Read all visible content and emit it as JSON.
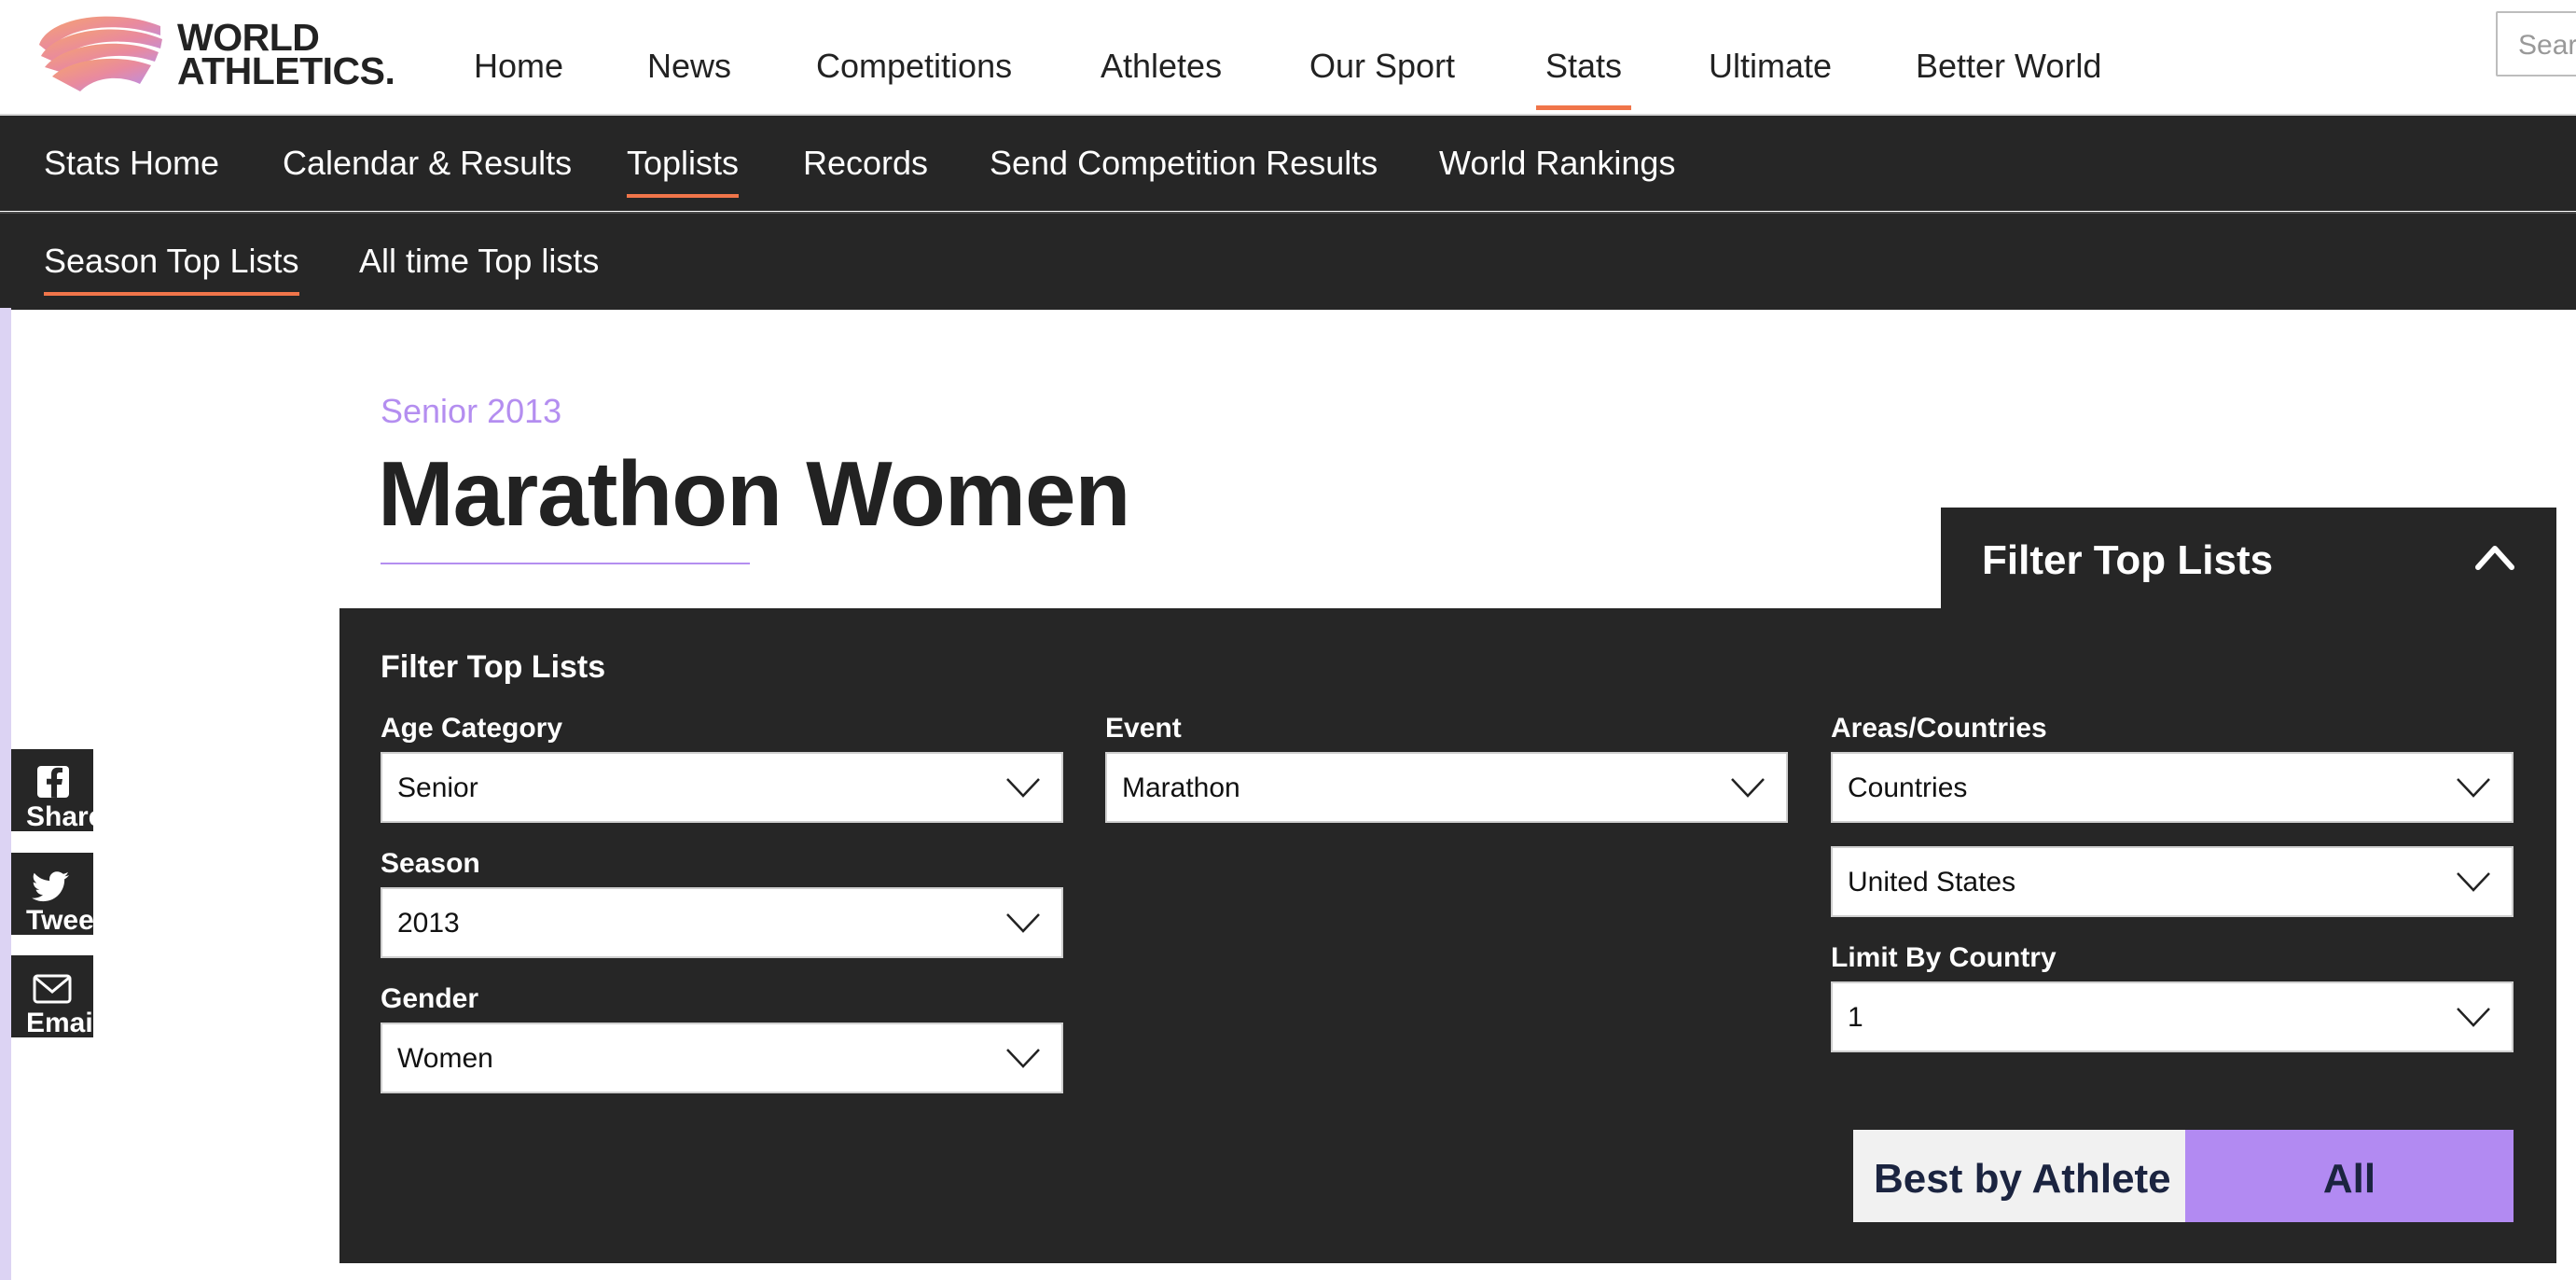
{
  "brand": {
    "logo_line1": "WORLD",
    "logo_line2": "ATHLETICS.",
    "colors": {
      "accent_orange": "#f0754a",
      "accent_purple": "#b48ef0",
      "dark": "#262626"
    }
  },
  "main_nav": {
    "items": [
      {
        "label": "Home",
        "active": false
      },
      {
        "label": "News",
        "active": false
      },
      {
        "label": "Competitions",
        "active": false
      },
      {
        "label": "Athletes",
        "active": false
      },
      {
        "label": "Our Sport",
        "active": false
      },
      {
        "label": "Stats",
        "active": true
      },
      {
        "label": "Ultimate",
        "active": false
      },
      {
        "label": "Better World",
        "active": false
      }
    ],
    "search_placeholder": "Search"
  },
  "stats_nav": {
    "items": [
      {
        "label": "Stats Home",
        "active": false
      },
      {
        "label": "Calendar & Results",
        "active": false
      },
      {
        "label": "Toplists",
        "active": true
      },
      {
        "label": "Records",
        "active": false
      },
      {
        "label": "Send Competition Results",
        "active": false
      },
      {
        "label": "World Rankings",
        "active": false
      }
    ]
  },
  "toplists_nav": {
    "items": [
      {
        "label": "Season Top Lists",
        "active": true
      },
      {
        "label": "All time Top lists",
        "active": false
      }
    ]
  },
  "share": {
    "facebook_label": "Share",
    "twitter_label": "Tweet",
    "email_label": "Email"
  },
  "page": {
    "subtitle": "Senior 2013",
    "title": "Marathon Women"
  },
  "filter": {
    "toggle_label": "Filter Top Lists",
    "panel_title": "Filter Top Lists",
    "age_category": {
      "label": "Age Category",
      "value": "Senior"
    },
    "season": {
      "label": "Season",
      "value": "2013"
    },
    "gender": {
      "label": "Gender",
      "value": "Women"
    },
    "event": {
      "label": "Event",
      "value": "Marathon"
    },
    "areas": {
      "label": "Areas/Countries",
      "value": "Countries"
    },
    "country": {
      "value": "United States"
    },
    "limit_by_country": {
      "label": "Limit By Country",
      "value": "1"
    },
    "toggle": {
      "best_by_athlete": "Best by Athlete",
      "all": "All",
      "selected": "All"
    }
  }
}
